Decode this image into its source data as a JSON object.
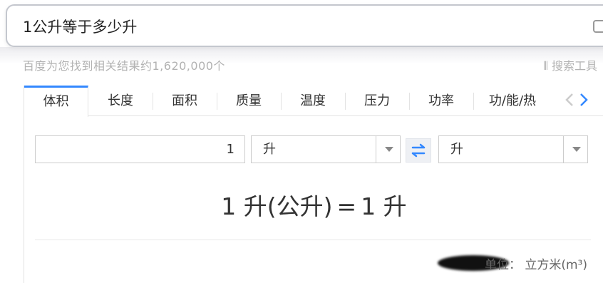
{
  "search": {
    "query": "1公升等于多少升"
  },
  "results_bar": {
    "count_text": "百度为您找到相关结果约1,620,000个",
    "tools_label": "搜索工具"
  },
  "converter": {
    "tabs": [
      {
        "label": "体积",
        "active": true
      },
      {
        "label": "长度",
        "active": false
      },
      {
        "label": "面积",
        "active": false
      },
      {
        "label": "质量",
        "active": false
      },
      {
        "label": "温度",
        "active": false
      },
      {
        "label": "压力",
        "active": false
      },
      {
        "label": "功率",
        "active": false
      },
      {
        "label": "功/能/热",
        "active": false
      }
    ],
    "input_value": "1",
    "from_unit": "升",
    "to_unit": "升",
    "result": {
      "left": "1 升(公升)",
      "op": "=",
      "right": "1 升"
    },
    "unit_note_label": "单位：",
    "unit_note_value": "立方米(m³)"
  },
  "colors": {
    "accent": "#3388ff",
    "arrow_disabled": "#cccccc",
    "border": "#e3e3e3",
    "text": "#333333"
  }
}
